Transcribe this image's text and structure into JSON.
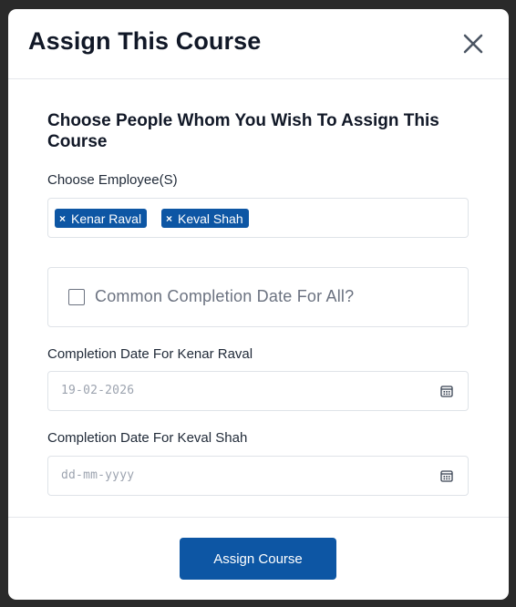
{
  "modal": {
    "title": "Assign This Course",
    "close_icon": "close-icon"
  },
  "form": {
    "heading": "Choose People Whom You Wish To Assign This Course",
    "employees_label": "Choose Employee(S)",
    "selected_employees": [
      {
        "name": "Kenar Raval",
        "remove_symbol": "×"
      },
      {
        "name": "Keval Shah",
        "remove_symbol": "×"
      }
    ],
    "common_date": {
      "label": "Common Completion Date For All?",
      "checked": false
    },
    "completion_dates": [
      {
        "label": "Completion Date For Kenar Raval",
        "value": "19-02-2026",
        "icon": "calendar-icon"
      },
      {
        "label": "Completion Date For Keval Shah",
        "placeholder": "dd-mm-yyyy",
        "icon": "calendar-icon"
      }
    ]
  },
  "footer": {
    "assign_button_label": "Assign Course"
  },
  "colors": {
    "primary": "#0d56a4",
    "backdrop": "#2a2a2a",
    "border": "#dfe3e8",
    "muted_text": "#6b7280"
  }
}
